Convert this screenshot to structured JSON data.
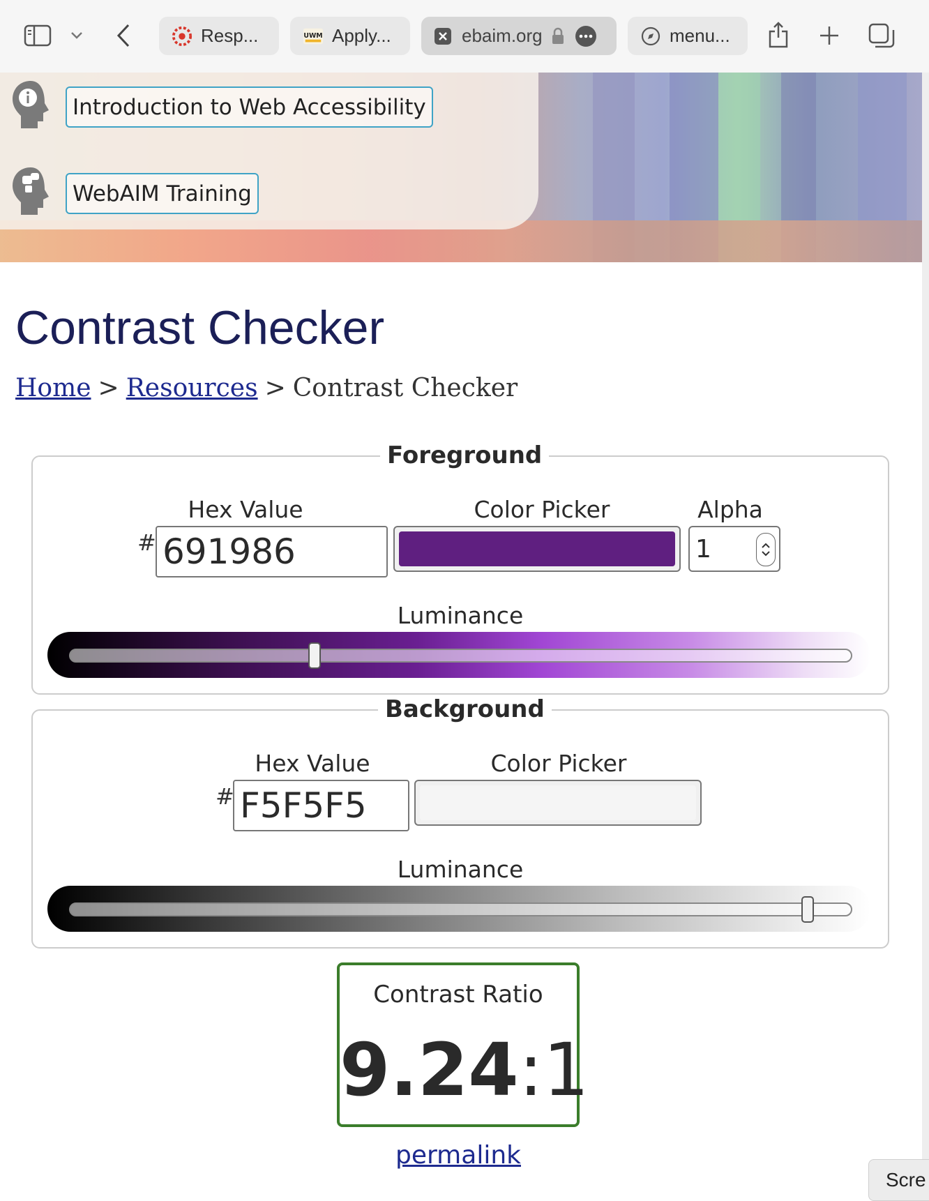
{
  "browser": {
    "tabs": [
      {
        "label": "Resp...",
        "icon": "canvas-logo-icon"
      },
      {
        "label": "Apply...",
        "icon": "uwm-logo-icon"
      },
      {
        "label": "ebaim.org",
        "icon": "close-tab-icon",
        "active": true
      },
      {
        "label": "menu...",
        "icon": "compass-icon"
      }
    ]
  },
  "banner": {
    "links": [
      "Introduction to Web Accessibility",
      "WebAIM Training"
    ]
  },
  "page": {
    "title": "Contrast Checker",
    "breadcrumb": {
      "home": "Home",
      "sep": ">",
      "resources": "Resources",
      "current": "Contrast Checker"
    }
  },
  "foreground": {
    "legend": "Foreground",
    "hex_label": "Hex Value",
    "hash": "#",
    "hex_value": "691986",
    "picker_label": "Color Picker",
    "alpha_label": "Alpha",
    "alpha_value": "1",
    "luminance_label": "Luminance",
    "luminance_level": 0.31,
    "swatch_color": "#5f1f80"
  },
  "background": {
    "legend": "Background",
    "hex_label": "Hex Value",
    "hash": "#",
    "hex_value": "F5F5F5",
    "picker_label": "Color Picker",
    "luminance_label": "Luminance",
    "luminance_level": 0.95,
    "swatch_color": "#f5f5f5"
  },
  "result": {
    "title": "Contrast Ratio",
    "ratio_main": "9.24",
    "ratio_suffix": ":1",
    "permalink": "permalink",
    "border_color": "#3b7d2b"
  },
  "overlay": {
    "screenshot_button": "Scre"
  }
}
